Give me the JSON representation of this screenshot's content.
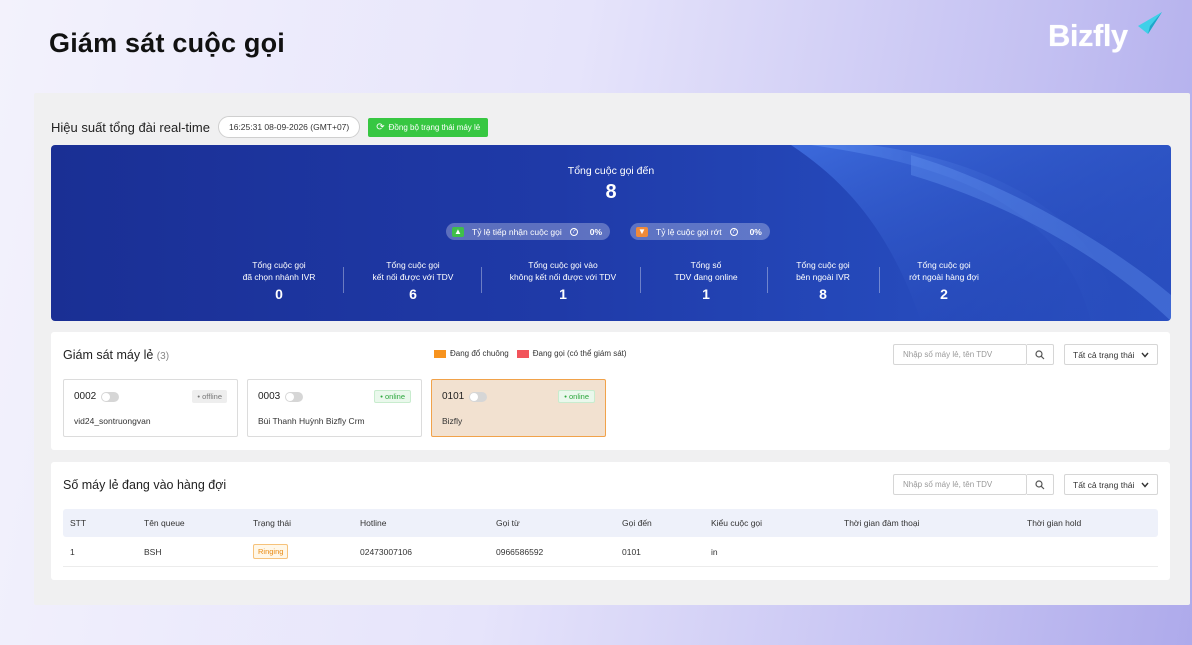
{
  "page": {
    "title": "Giám sát cuộc gọi",
    "logo": "Bizfly"
  },
  "performance": {
    "title": "Hiệu suất tổng đài real-time",
    "datetime": "16:25:31 08-09-2026   (GMT+07)",
    "sync_label": "Đồng bộ trạng thái máy lẻ"
  },
  "banner": {
    "total_label": "Tổng cuộc gọi đến",
    "total_value": "8",
    "accept_rate_label": "Tỷ lệ tiếp nhận cuộc gọi",
    "accept_rate_value": "0%",
    "drop_rate_label": "Tỷ lệ cuộc gọi rớt",
    "drop_rate_value": "0%",
    "stats": [
      {
        "line1": "Tổng cuộc gọi",
        "line2": "đã chọn nhánh IVR",
        "value": "0"
      },
      {
        "line1": "Tổng cuộc gọi",
        "line2": "kết nối được với TDV",
        "value": "6"
      },
      {
        "line1": "Tổng cuộc gọi vào",
        "line2": "không kết nối được với TDV",
        "value": "1"
      },
      {
        "line1": "Tổng số",
        "line2": "TDV đang online",
        "value": "1"
      },
      {
        "line1": "Tổng cuộc gọi",
        "line2": "bên ngoài IVR",
        "value": "8"
      },
      {
        "line1": "Tổng cuộc gọi",
        "line2": "rớt ngoài hàng đợi",
        "value": "2"
      }
    ]
  },
  "extensions": {
    "title": "Giám sát máy lẻ",
    "count": "(3)",
    "legend_ringing": "Đang đổ chuông",
    "legend_calling": "Đang gọi (có thể giám sát)",
    "search_placeholder": "Nhập số máy lẻ, tên TDV",
    "status_filter": "Tất cả trạng thái",
    "colors": {
      "ringing": "#f7931e",
      "calling": "#f2545b"
    },
    "items": [
      {
        "number": "0002",
        "status": "• offline",
        "name": "vid24_sontruongvan"
      },
      {
        "number": "0003",
        "status": "• online",
        "name": "Bùi Thanh Huỳnh Bizfly Crm"
      },
      {
        "number": "0101",
        "status": "• online",
        "name": "Bizfly"
      }
    ]
  },
  "queue": {
    "title": "Số máy lẻ đang vào hàng đợi",
    "search_placeholder": "Nhập số máy lẻ, tên TDV",
    "status_filter": "Tất cả trạng thái",
    "columns": [
      "STT",
      "Tên queue",
      "Trạng thái",
      "Hotline",
      "Gọi từ",
      "Gọi đến",
      "Kiểu cuộc gọi",
      "Thời gian đàm thoại",
      "Thời gian hold"
    ],
    "rows": [
      {
        "stt": "1",
        "queue": "BSH",
        "status": "Ringing",
        "hotline": "02473007106",
        "from": "0966586592",
        "to": "0101",
        "type": "in",
        "talk_time": "",
        "hold_time": ""
      }
    ]
  }
}
